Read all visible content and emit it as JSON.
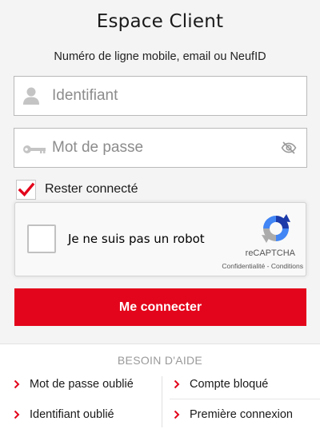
{
  "header": {
    "title": "Espace Client",
    "subtitle": "Numéro de ligne mobile, email ou NeufID"
  },
  "form": {
    "username_placeholder": "Identifiant",
    "password_placeholder": "Mot de passe",
    "remember_label": "Rester connecté",
    "remember_checked": true,
    "submit_label": "Me connecter"
  },
  "recaptcha": {
    "label": "Je ne suis pas un robot",
    "brand": "reCAPTCHA",
    "privacy": "Confidentialité",
    "separator": " - ",
    "terms": "Conditions"
  },
  "help": {
    "title": "BESOIN D'AIDE",
    "links": [
      {
        "label": "Mot de passe oublié"
      },
      {
        "label": "Compte bloqué"
      },
      {
        "label": "Identifiant oublié"
      },
      {
        "label": "Première connexion"
      }
    ]
  },
  "icons": {
    "user": "user-icon",
    "key": "key-icon",
    "eye": "eye-slash-icon",
    "check": "check-icon",
    "recaptcha": "recaptcha-logo-icon",
    "chevron": "chevron-right-icon"
  },
  "colors": {
    "brand_red": "#e3051b",
    "background": "#f4f4f4"
  }
}
